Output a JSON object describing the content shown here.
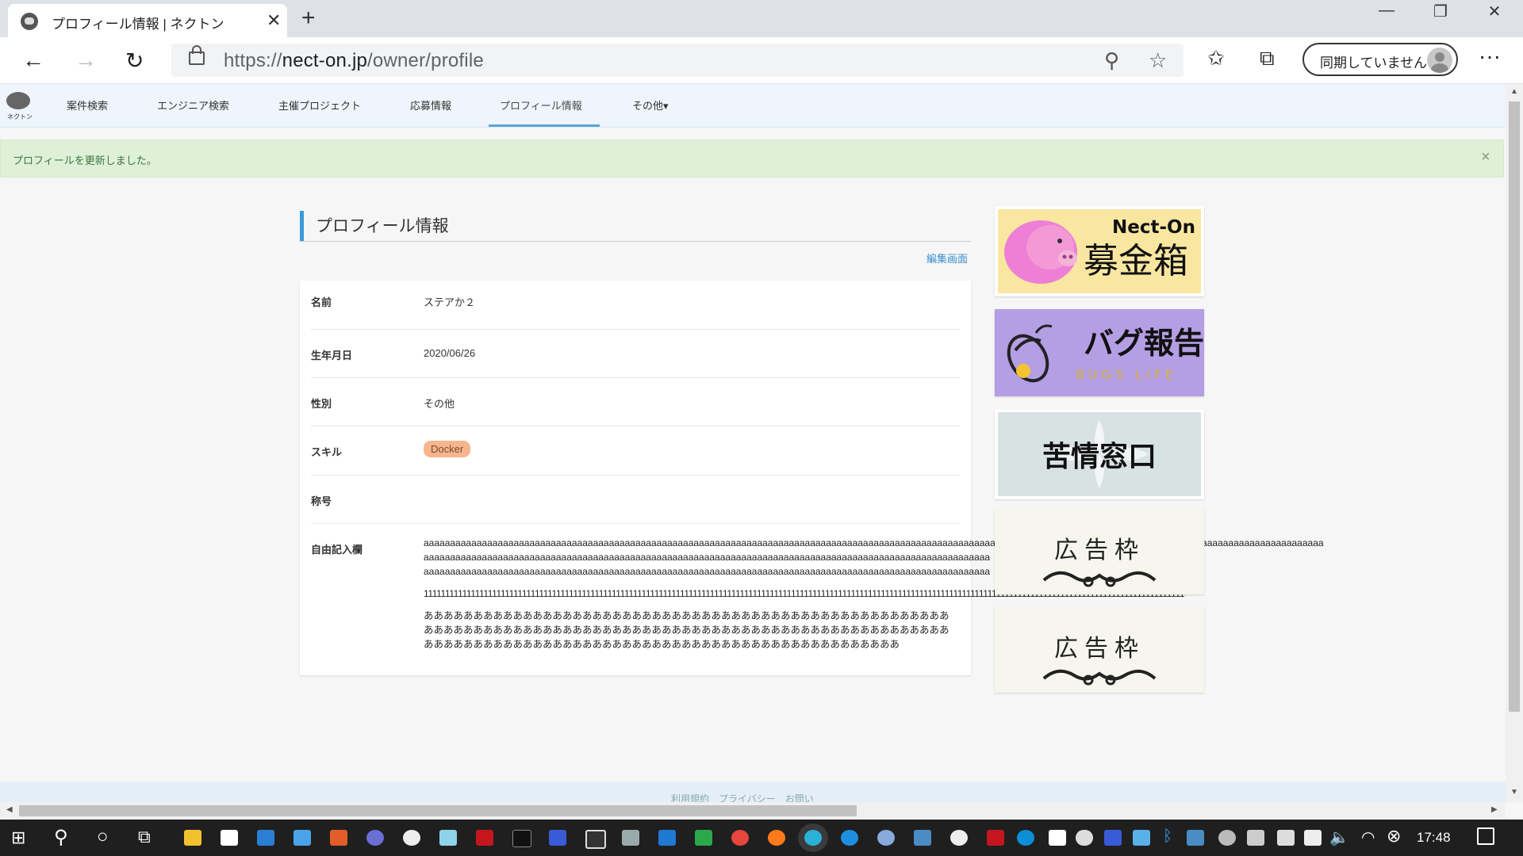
{
  "browser": {
    "tab_title": "プロフィール情報 | ネクトン",
    "url_scheme": "https://",
    "url_host": "nect-on.jp",
    "url_path": "/owner/profile",
    "sync_label": "同期していません"
  },
  "site": {
    "logo_text": "ネクトン",
    "nav": [
      "案件検索",
      "エンジニア検索",
      "主催プロジェクト",
      "応募情報",
      "プロフィール情報",
      "その他▾"
    ],
    "active_nav": "プロフィール情報"
  },
  "alert": {
    "message": "プロフィールを更新しました。",
    "close": "×"
  },
  "profile": {
    "title": "プロフィール情報",
    "edit_link": "編集画面",
    "rows": [
      {
        "label": "名前",
        "value": "ステアか２"
      },
      {
        "label": "生年月日",
        "value": "2020/06/26"
      },
      {
        "label": "性別",
        "value": "その他"
      },
      {
        "label": "スキル",
        "value": "Docker"
      },
      {
        "label": "称号",
        "value": ""
      },
      {
        "label": "自由記入欄",
        "value": ""
      }
    ],
    "free_text": {
      "line_a1": "aaaaaaaaaaaaaaaaaaaaaaaaaaaaaaaaaaaaaaaaaaaaaaaaaaaaaaaaaaaaaaaaaaaaaaaaaaaaaaaaaaaaaaaaaaaaaaaaaaaaaaaaaaaaaaaaaaaaaaaaaaaaaaaaaaaaaaaaaaaaaaaaaaaaaaaaaaaaaaaaaaaaaaaaaa",
      "line_a2": "aaaaaaaaaaaaaaaaaaaaaaaaaaaaaaaaaaaaaaaaaaaaaaaaaaaaaaaaaaaaaaaaaaaaaaaaaaaaaaaaaaaaaaaaaaaaaaaaaaaaaaaaaaa",
      "line_a3": "aaaaaaaaaaaaaaaaaaaaaaaaaaaaaaaaaaaaaaaaaaaaaaaaaaaaaaaaaaaaaaaaaaaaaaaaaaaaaaaaaaaaaaaaaaaaaaaaaaaaaaaaaaa",
      "line_1": "1111111111111111111111111111111111111111111111111111111111111111111111111111111111111111111111111111111111111111111111111111111111111111111111111111111111111111111111111111111111",
      "line_h1": "あああああああああああああああああああああああああああああああああああああああああああああああああああああ",
      "line_h2": "あああああああああああああああああああああああああああああああああああああああああああああああああああああ",
      "line_h3": "ああああああああああああああああああああああああああああああああああああああああああああああああ"
    }
  },
  "ads": {
    "donation_brand": "Nect-On",
    "donation_label": "募金箱",
    "bug_label": "バグ報告",
    "bug_sub": "BUGS LIFE",
    "complaint_label": "苦情窓口",
    "ad_label_1": "広告枠",
    "ad_label_2": "広告枠"
  },
  "footer": {
    "links": "利用規約　プライバシー　お問い"
  },
  "taskbar": {
    "time": "17:48"
  },
  "colors": {
    "accent": "#3a9ad9",
    "alert_bg": "#dff0d8",
    "skill_badge": "#f7b58d",
    "bug_banner": "#b49ee4",
    "donation_banner": "#f9e7a1"
  }
}
